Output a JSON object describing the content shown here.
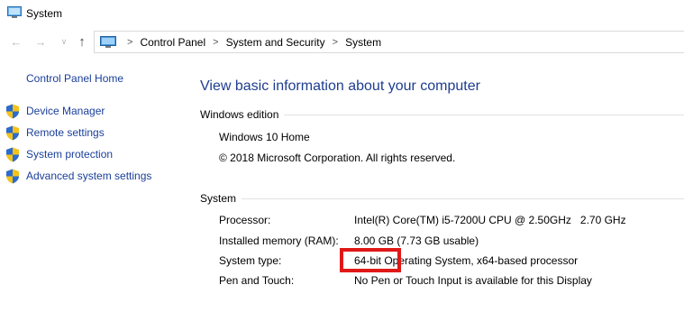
{
  "window": {
    "title": "System"
  },
  "nav": {
    "back_glyph": "←",
    "forward_glyph": "→",
    "recent_glyph": "∨",
    "up_glyph": "↑"
  },
  "breadcrumb": [
    "Control Panel",
    "System and Security",
    "System"
  ],
  "breadcrumb_sep": ">",
  "sidebar": {
    "home": "Control Panel Home",
    "items": [
      {
        "label": "Device Manager",
        "icon": "shield-icon"
      },
      {
        "label": "Remote settings",
        "icon": "shield-icon"
      },
      {
        "label": "System protection",
        "icon": "shield-icon"
      },
      {
        "label": "Advanced system settings",
        "icon": "shield-icon"
      }
    ]
  },
  "main": {
    "title": "View basic information about your computer",
    "edition": {
      "header": "Windows edition",
      "name": "Windows 10 Home",
      "copyright": "© 2018 Microsoft Corporation. All rights reserved."
    },
    "system": {
      "header": "System",
      "rows": [
        {
          "label": "Processor:",
          "value": "Intel(R) Core(TM) i5-7200U CPU @ 2.50GHz   2.70 GHz"
        },
        {
          "label": "Installed memory (RAM):",
          "value": "8.00 GB (7.73 GB usable)"
        },
        {
          "label": "System type:",
          "value": "64-bit Operating System, x64-based processor"
        },
        {
          "label": "Pen and Touch:",
          "value": "No Pen or Touch Input is available for this Display"
        }
      ]
    }
  },
  "colors": {
    "link": "#1a3f99",
    "title": "#1e3d8f",
    "highlight": "#e01818"
  }
}
